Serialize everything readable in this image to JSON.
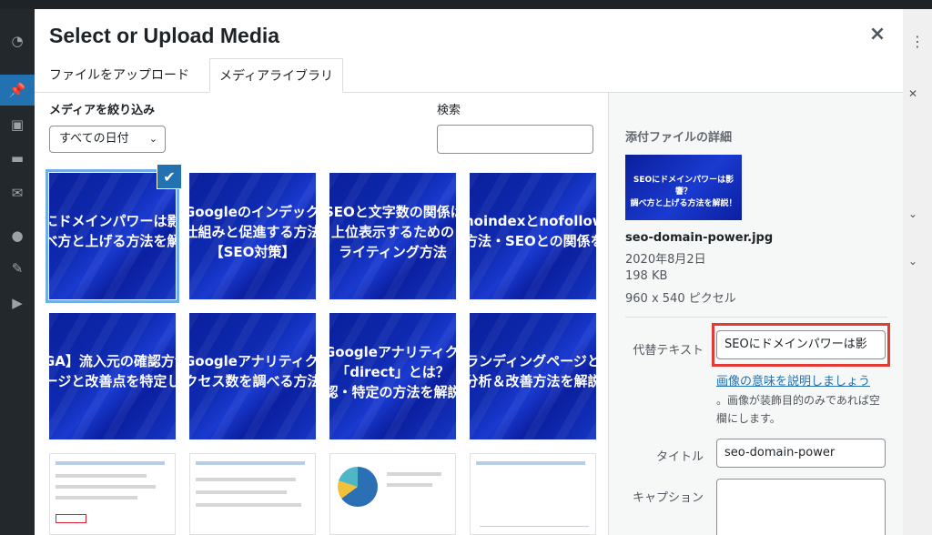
{
  "modal": {
    "title": "Select or Upload Media",
    "close_icon": "×"
  },
  "tabs": [
    {
      "label": "ファイルをアップロード",
      "active": false
    },
    {
      "label": "メディアライブラリ",
      "active": true
    }
  ],
  "filter": {
    "label": "メディアを絞り込み",
    "selected": "すべての日付"
  },
  "search": {
    "label": "検索",
    "value": ""
  },
  "grid": {
    "row1": [
      {
        "caption1": "にドメインパワーは影",
        "caption2": "べ方と上げる方法を解",
        "selected": true
      },
      {
        "caption1": "Googleのインデックス",
        "caption2": "仕組みと促進する方法",
        "caption3": "【SEO対策】"
      },
      {
        "caption1": "SEOと文字数の関係は",
        "caption2": "上位表示するための",
        "caption3": "ライティング方法"
      },
      {
        "caption1": "noindexとnofollow",
        "caption2": "方法・SEOとの関係を"
      }
    ],
    "row2": [
      {
        "caption1": "GA】流入元の確認方法",
        "caption2": "ージと改善点を特定し"
      },
      {
        "caption1": "Googleアナリティクス",
        "caption2": "クセス数を調べる方法"
      },
      {
        "caption1": "Googleアナリティクス",
        "caption2": "「direct」とは？",
        "caption3": "認・特定の方法を解説"
      },
      {
        "caption1": "ランディングページと",
        "caption2": "分析＆改善方法を解説"
      }
    ]
  },
  "attachment": {
    "heading": "添付ファイルの詳細",
    "thumb_caption1": "SEOにドメインパワーは影響？",
    "thumb_caption2": "調べ方と上げる方法を解説！",
    "filename": "seo-domain-power.jpg",
    "date": "2020年8月2日",
    "size": "198 KB",
    "dimensions": "960 x 540 ピクセル",
    "alt_label": "代替テキスト",
    "alt_value": "SEOにドメインパワーは影",
    "alt_link": "画像の意味を説明しましょう",
    "alt_help": "。画像が装飾目的のみであれば空欄にします。",
    "title_label": "タイトル",
    "title_value": "seo-domain-power",
    "caption_label": "キャプション"
  },
  "colors": {
    "accent": "#2271b1",
    "highlight_box": "#e53935"
  }
}
